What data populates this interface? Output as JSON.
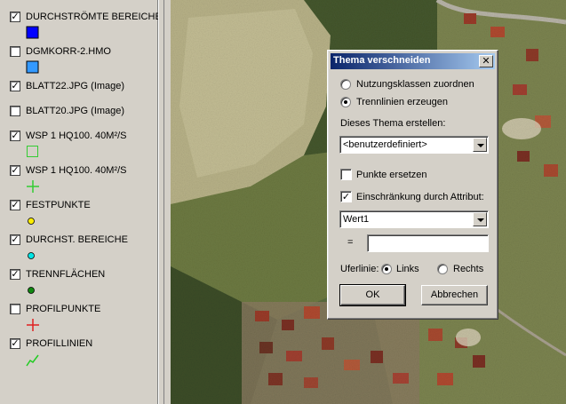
{
  "legend": {
    "items": [
      {
        "label": "DURCHSTRÖMTE BEREICHE",
        "checked": true,
        "checkmark": "✓",
        "symbol": "filled-square",
        "color": "#0000ff"
      },
      {
        "label": "DGMKORR-2.HMO",
        "checked": false,
        "checkmark": "",
        "symbol": "filled-square",
        "color": "#3399ff"
      },
      {
        "label": "BLATT22.JPG (Image)",
        "checked": true,
        "checkmark": "✓",
        "symbol": "none",
        "color": ""
      },
      {
        "label": "BLATT20.JPG (Image)",
        "checked": false,
        "checkmark": "",
        "symbol": "none",
        "color": ""
      },
      {
        "label": "WSP 1 HQ100. 40M²/S",
        "checked": true,
        "checkmark": "✓",
        "symbol": "outline-square",
        "color": "#33cc33"
      },
      {
        "label": "WSP 1 HQ100. 40M²/S",
        "checked": true,
        "checkmark": "✓",
        "symbol": "cross",
        "color": "#33cc33"
      },
      {
        "label": "FESTPUNKTE",
        "checked": true,
        "checkmark": "✓",
        "symbol": "dot",
        "color": "#ffee00"
      },
      {
        "label": "DURCHST. BEREICHE",
        "checked": true,
        "checkmark": "✓",
        "symbol": "dot",
        "color": "#00e5e5"
      },
      {
        "label": "TRENNFLÄCHEN",
        "checked": true,
        "checkmark": "✓",
        "symbol": "dot",
        "color": "#118811"
      },
      {
        "label": "PROFILPUNKTE",
        "checked": false,
        "checkmark": "",
        "symbol": "cross",
        "color": "#e02020"
      },
      {
        "label": "PROFILLINIEN",
        "checked": true,
        "checkmark": "✓",
        "symbol": "zigzag",
        "color": "#22cc22"
      }
    ]
  },
  "dialog": {
    "title": "Thema verschneiden",
    "close_glyph": "✕",
    "radio_nutzung": {
      "label": "Nutzungsklassen zuordnen",
      "selected": false
    },
    "radio_trenn": {
      "label": "Trennlinien erzeugen",
      "selected": true
    },
    "create_label": "Dieses Thema erstellen:",
    "create_value": "<benutzerdefiniert>",
    "replace_points": {
      "label": "Punkte ersetzen",
      "checked": false,
      "checkmark": ""
    },
    "restrict_attr": {
      "label": "Einschränkung durch Attribut:",
      "checked": true,
      "checkmark": "✓"
    },
    "attr_value": "Wert1",
    "equals_label": "=",
    "equals_value": "",
    "bank_label": "Uferlinie:",
    "bank_left": {
      "label": "Links",
      "selected": true
    },
    "bank_right": {
      "label": "Rechts",
      "selected": false
    },
    "ok_label": "OK",
    "cancel_label": "Abbrechen"
  }
}
